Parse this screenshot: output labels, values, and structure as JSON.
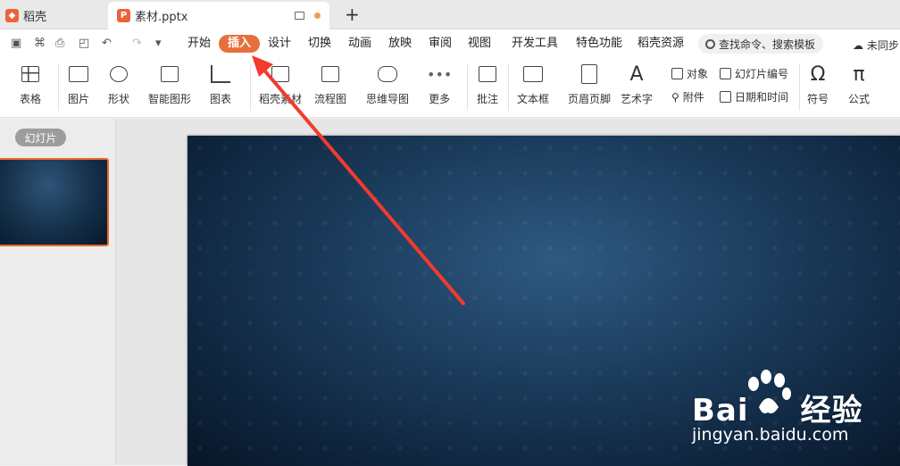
{
  "tabs": {
    "home": "稻壳",
    "doc": "素材.pptx",
    "new_tab": "+"
  },
  "menu": {
    "items": [
      "开始",
      "插入",
      "设计",
      "切换",
      "动画",
      "放映",
      "审阅",
      "视图",
      "开发工具",
      "特色功能",
      "稻壳资源"
    ],
    "active": "插入",
    "search_placeholder": "查找命令、搜索模板",
    "sync": "未同步"
  },
  "ribbon": {
    "tools": [
      "表格",
      "图片",
      "形状",
      "智能图形",
      "图表",
      "稻壳素材",
      "流程图",
      "思维导图",
      "更多",
      "批注",
      "文本框",
      "页眉页脚",
      "艺术字",
      "符号",
      "公式"
    ],
    "small": [
      "对象",
      "附件",
      "幻灯片编号",
      "日期和时间"
    ]
  },
  "panel": {
    "pill": "幻灯片"
  },
  "watermark": {
    "brand_a": "Bai",
    "brand_b": "经验",
    "url": "jingyan.baidu.com"
  },
  "colors": {
    "accent": "#e76f3b",
    "arrow": "#f23a2e"
  }
}
